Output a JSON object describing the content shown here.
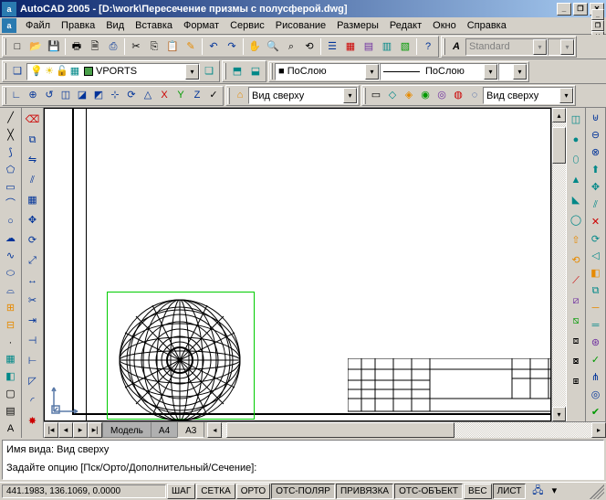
{
  "titlebar": {
    "app_icon": "a",
    "text": "AutoCAD 2005 - [D:\\work\\Пересечение призмы с полусферой.dwg]"
  },
  "menu": {
    "items": [
      "Файл",
      "Правка",
      "Вид",
      "Вставка",
      "Формат",
      "Сервис",
      "Рисование",
      "Размеры",
      "Редакт",
      "Окно",
      "Справка"
    ]
  },
  "toolbars": {
    "style_combo": "Standard",
    "layer_combo": "VPORTS",
    "color_combo": "■ ПоСлою",
    "linetype_combo": "ПоСлою",
    "view_combo": "Вид сверху",
    "view_combo2": "Вид сверху"
  },
  "tabs": {
    "nav_first": "|◂",
    "nav_prev": "◂",
    "nav_next": "▸",
    "nav_last": "▸|",
    "items": [
      "Модель",
      "A4",
      "A3"
    ]
  },
  "cmd": {
    "line1": "Имя вида: Вид сверху",
    "line2": "Задайте опцию [Пск/Орто/Дополнительный/Сечение]:"
  },
  "status": {
    "coords": "441.1983, 136.1069, 0.0000",
    "buttons": [
      "ШАГ",
      "СЕТКА",
      "ОРТО",
      "ОТС-ПОЛЯР",
      "ПРИВЯЗКА",
      "ОТС-ОБЪЕКТ",
      "ВЕС",
      "ЛИСТ"
    ],
    "active": [
      "ОТС-ПОЛЯР",
      "ПРИВЯЗКА",
      "ОТС-ОБЪЕКТ",
      "ЛИСТ"
    ]
  },
  "colors": {
    "accent": "#0a246a",
    "bg": "#d4d0c8",
    "select": "#00cc00"
  }
}
